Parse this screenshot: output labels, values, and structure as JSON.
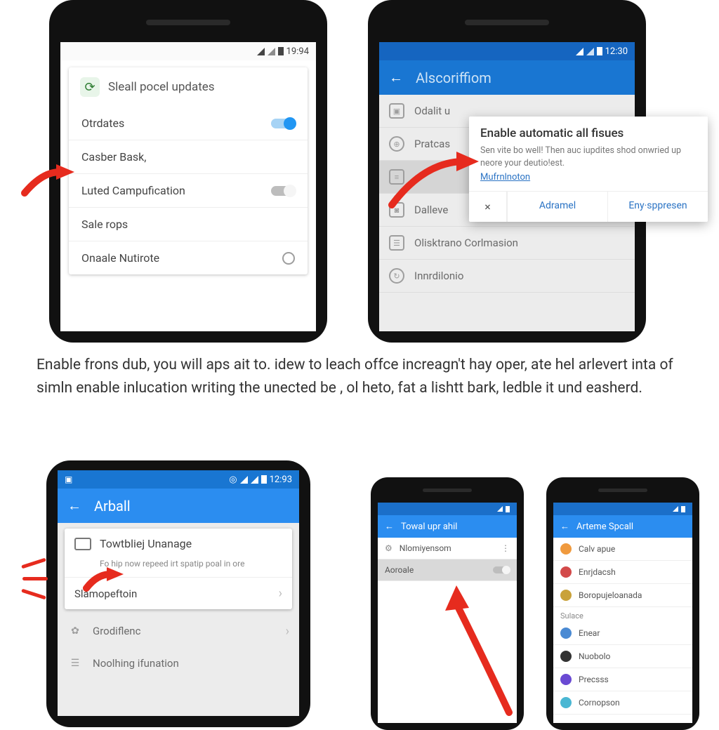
{
  "top_left_phone": {
    "status_time": "19:94",
    "card_title": "Sleall pocel updates",
    "rows": [
      {
        "label": "Otrdates",
        "control": "toggle_on"
      },
      {
        "label": "Casber Bask,",
        "control": "none"
      },
      {
        "label": "Luted Campufication",
        "control": "toggle_off"
      },
      {
        "label": "Sale rops",
        "control": "none"
      },
      {
        "label": "Onaale Nutirote",
        "control": "radio_empty"
      }
    ]
  },
  "top_right_phone": {
    "status_time": "12:30",
    "header_title": "Alscoriffiom",
    "list": [
      {
        "icon": "folder",
        "label": "Odalit u"
      },
      {
        "icon": "globe",
        "label": "Pratcas"
      },
      {
        "icon": "lines",
        "label": "",
        "selected": true
      },
      {
        "icon": "camera",
        "label": "Dalleve"
      },
      {
        "icon": "doc",
        "label": "Olisktrano Corlmasion"
      },
      {
        "icon": "sync",
        "label": "Innrdilonio"
      }
    ],
    "dialog": {
      "title": "Enable automatic all fisues",
      "body": "Sen vite bo well! Then auc iupdites shod onwried up neore your deutio!est.",
      "link": "Mufrnlnoton",
      "close_icon_label": "×",
      "button1": "Adramel",
      "button2": "Eny·sppresen"
    }
  },
  "paragraph": "Enable frons dub, you will aps ait to. idew to leach offce increagn't hay oper, ate hel arlevert inta of simln enable inlucation writing the unected be , ol heto, fat a lishtt bark, ledble it und easherd.",
  "bottom_left_phone": {
    "status_time": "12:93",
    "header_title": "Arball",
    "card": {
      "title": "Towtbliej Unanage",
      "subtitle": "Fo  hip now repeed irt spatip poal in ore",
      "row2": "Slamopeftoin"
    },
    "rows": [
      {
        "icon": "leaf",
        "label": "Grodiflenc"
      },
      {
        "icon": "doc",
        "label": "Noolhing ifunation"
      }
    ]
  },
  "bottom_mid_phone": {
    "header_title": "Towal upr ahil",
    "rows": [
      {
        "icon": "gear",
        "label": "Nlomiyensom",
        "trailing": "more"
      },
      {
        "icon": "",
        "label": "Aoroale",
        "trailing": "toggle",
        "selected": true
      }
    ]
  },
  "bottom_right_phone": {
    "header_title": "Arteme Spcall",
    "rows": [
      {
        "color": "#f09a3e",
        "label": "Calv apue"
      },
      {
        "color": "#d34a4a",
        "label": "Enrjdacsh"
      },
      {
        "color": "#c9a23a",
        "label": "Boropujeloanada"
      }
    ],
    "section": "Sulace",
    "rows2": [
      {
        "color": "#4a8ad3",
        "label": "Enear"
      },
      {
        "color": "#333",
        "label": "Nuobolo"
      },
      {
        "color": "#6a4ad3",
        "label": "Precsss"
      },
      {
        "color": "#4ab7d3",
        "label": "Cornopson"
      }
    ]
  }
}
